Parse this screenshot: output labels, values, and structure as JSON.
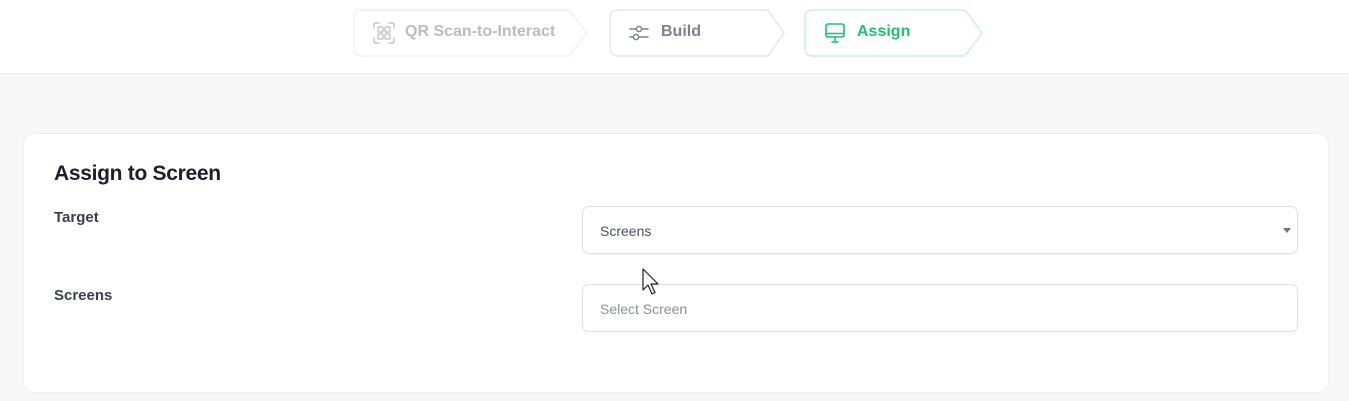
{
  "steps": [
    {
      "label": "QR Scan-to-Interact",
      "icon": "qr-scan-icon",
      "state": "disabled"
    },
    {
      "label": "Build",
      "icon": "sliders-icon",
      "state": "default"
    },
    {
      "label": "Assign",
      "icon": "monitor-icon",
      "state": "active"
    }
  ],
  "colors": {
    "accent": "#1fbf74",
    "disabled_text": "#b9bcc3",
    "default_text": "#7b8290",
    "page_bg": "#f7f7f7"
  },
  "assign": {
    "title": "Assign to Screen",
    "target_label": "Target",
    "target_value": "Screens",
    "screens_label": "Screens",
    "screens_placeholder": "Select Screen"
  }
}
